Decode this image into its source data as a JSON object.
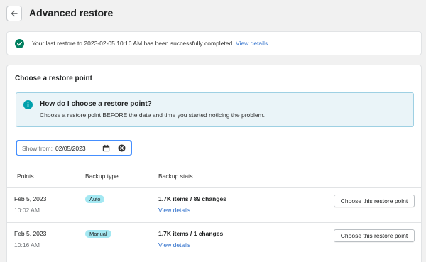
{
  "header": {
    "title": "Advanced restore",
    "back_icon": "arrow-left-icon"
  },
  "banner": {
    "message": "Your last restore to 2023-02-05 10:16 AM has been successfully completed.",
    "link": "View details.",
    "icon": "check-circle-icon",
    "color": "#007f5f"
  },
  "restore_section": {
    "title": "Choose a restore point",
    "info": {
      "icon": "info-icon",
      "title": "How do I choose a restore point?",
      "description": "Choose a restore point BEFORE the date and time you started noticing the problem."
    },
    "filter": {
      "label": "Show from:",
      "value": "02/05/2023"
    },
    "columns": [
      "Points",
      "Backup type",
      "Backup stats"
    ],
    "rows": [
      {
        "date": "Feb 5, 2023",
        "time": "10:02 AM",
        "type": "Auto",
        "stats": "1.7K items / 89 changes",
        "link": "View details",
        "action": "Choose this restore point"
      },
      {
        "date": "Feb 5, 2023",
        "time": "10:16 AM",
        "type": "Manual",
        "stats": "1.7K items / 1 changes",
        "link": "View details",
        "action": "Choose this restore point"
      }
    ]
  },
  "colors": {
    "accent": "#2c6ecb",
    "info_bg": "#eaf4f8",
    "badge_bg": "#a4e8f2",
    "focus": "#458fff"
  }
}
